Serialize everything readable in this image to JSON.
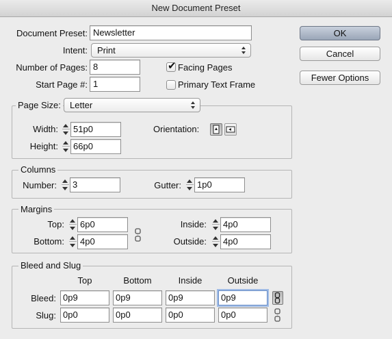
{
  "window": {
    "title": "New Document Preset"
  },
  "preset": {
    "label": "Document Preset:",
    "value": "Newsletter"
  },
  "intent": {
    "label": "Intent:",
    "value": "Print"
  },
  "pages": {
    "num_label": "Number of Pages:",
    "num_value": "8",
    "start_label": "Start Page #:",
    "start_value": "1",
    "facing_label": "Facing Pages",
    "facing_checked": true,
    "primary_label": "Primary Text Frame",
    "primary_checked": false
  },
  "buttons": {
    "ok": "OK",
    "cancel": "Cancel",
    "fewer": "Fewer Options"
  },
  "page_size": {
    "label": "Page Size:",
    "value": "Letter",
    "width_label": "Width:",
    "width_value": "51p0",
    "height_label": "Height:",
    "height_value": "66p0",
    "orientation_label": "Orientation:",
    "orientation_selected": "portrait"
  },
  "columns": {
    "title": "Columns",
    "number_label": "Number:",
    "number_value": "3",
    "gutter_label": "Gutter:",
    "gutter_value": "1p0"
  },
  "margins": {
    "title": "Margins",
    "top_label": "Top:",
    "top_value": "6p0",
    "bottom_label": "Bottom:",
    "bottom_value": "4p0",
    "inside_label": "Inside:",
    "inside_value": "4p0",
    "outside_label": "Outside:",
    "outside_value": "4p0",
    "linked": false
  },
  "bleed_slug": {
    "title": "Bleed and Slug",
    "headers": [
      "Top",
      "Bottom",
      "Inside",
      "Outside"
    ],
    "bleed_label": "Bleed:",
    "bleed_values": [
      "0p9",
      "0p9",
      "0p9",
      "0p9"
    ],
    "bleed_linked": true,
    "slug_label": "Slug:",
    "slug_values": [
      "0p0",
      "0p0",
      "0p0",
      "0p0"
    ],
    "slug_linked": false
  }
}
